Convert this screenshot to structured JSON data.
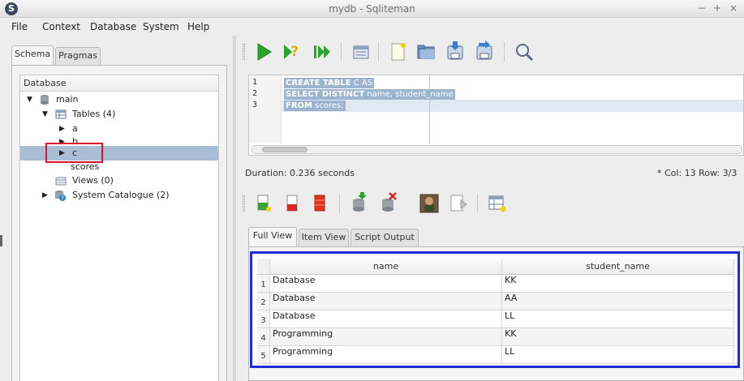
{
  "window": {
    "title": "mydb - Sqliteman",
    "app_icon": "S",
    "minimize": "−",
    "maximize": "+",
    "close": "×"
  },
  "menu": [
    "File",
    "Context",
    "Database",
    "System",
    "Help"
  ],
  "left": {
    "tabs": [
      "Schema",
      "Pragmas"
    ],
    "tree_header": "Database",
    "tree": [
      {
        "label": "main",
        "icon": "database-icon"
      },
      {
        "label": "Tables (4)",
        "icon": "table-icon"
      },
      {
        "label": "a"
      },
      {
        "label": "b"
      },
      {
        "label": "c"
      },
      {
        "label": "scores"
      },
      {
        "label": "Views (0)",
        "icon": "view-icon"
      },
      {
        "label": "System Catalogue (2)",
        "icon": "catalogue-icon"
      }
    ]
  },
  "toolbar_top": [
    "run-icon",
    "explain-icon",
    "run-script-icon",
    "history-icon",
    "new-file-icon",
    "open-file-icon",
    "save-icon",
    "save-as-icon",
    "search-icon"
  ],
  "editor": {
    "line_numbers": [
      "1",
      "2",
      "3"
    ],
    "lines": [
      {
        "kw": "CREATE TABLE",
        "rest": " C AS"
      },
      {
        "kw": "SELECT DISTINCT",
        "rest": " name, student_name"
      },
      {
        "kw": "FROM",
        "rest": " scores;"
      }
    ]
  },
  "status": {
    "duration": "Duration: 0.236 seconds",
    "position": "*  Col: 13 Row: 3/3"
  },
  "toolbar_bottom": [
    "insert-row-icon",
    "remove-row-icon",
    "truncate-icon",
    "commit-icon",
    "rollback-icon",
    "blob-icon",
    "export-icon",
    "new-table-icon"
  ],
  "result": {
    "tabs": [
      "Full View",
      "Item View",
      "Script Output"
    ],
    "columns": [
      "name",
      "student_name"
    ],
    "rows": [
      {
        "n": "1",
        "name": "Database",
        "student_name": "KK"
      },
      {
        "n": "2",
        "name": "Database",
        "student_name": "AA"
      },
      {
        "n": "3",
        "name": "Database",
        "student_name": "LL"
      },
      {
        "n": "4",
        "name": "Programming",
        "student_name": "KK"
      },
      {
        "n": "5",
        "name": "Programming",
        "student_name": "LL"
      }
    ]
  },
  "colors": {
    "highlight_blue": "#1c2ed8",
    "highlight_red": "#e0102a",
    "selection": "#a9bed5"
  }
}
